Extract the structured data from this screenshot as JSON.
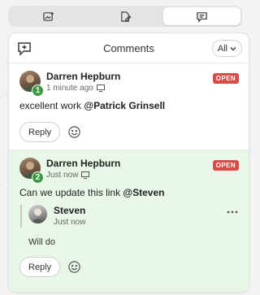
{
  "toolbar": {
    "tabs": [
      {
        "icon": "image-add-icon",
        "active": false
      },
      {
        "icon": "document-edit-icon",
        "active": false
      },
      {
        "icon": "comment-icon",
        "active": true
      }
    ]
  },
  "panel": {
    "title": "Comments",
    "filter": {
      "selected": "All",
      "icon": "chevron-down-icon"
    }
  },
  "threads": [
    {
      "number": "1",
      "author": "Darren Hepburn",
      "timestamp": "1 minute ago",
      "status": "OPEN",
      "text": "excellent work",
      "mention": "@Patrick Grinsell",
      "reply_label": "Reply"
    },
    {
      "number": "2",
      "author": "Darren Hepburn",
      "timestamp": "Just now",
      "status": "OPEN",
      "text": "Can we update this link",
      "mention": "@Steven",
      "reply": {
        "author": "Steven",
        "timestamp": "Just now",
        "text": "Will do"
      },
      "reply_label": "Reply"
    }
  ],
  "colors": {
    "status_open": "#e04848",
    "badge_green": "#3a9a3f",
    "highlight_bg": "#e9f7e9"
  }
}
